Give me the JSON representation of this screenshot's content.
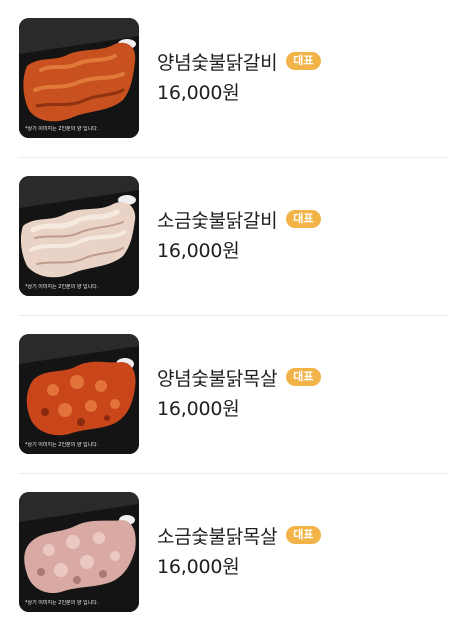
{
  "menu": {
    "items": [
      {
        "name": "양념숯불닭갈비",
        "badge": "대표",
        "price": "16,000원",
        "image_caption": "*상기 이미지는 2인분의 양 입니다.",
        "meat_color": "#c8511f",
        "meat_highlight": "#e07a3a",
        "meat_shadow": "#8e3210"
      },
      {
        "name": "소금숯불닭갈비",
        "badge": "대표",
        "price": "16,000원",
        "image_caption": "*상기 이미지는 2인분의 양 입니다.",
        "meat_color": "#e9d3c6",
        "meat_highlight": "#f6e9e0",
        "meat_shadow": "#bf9c8c"
      },
      {
        "name": "양념숯불닭목살",
        "badge": "대표",
        "price": "16,000원",
        "image_caption": "*상기 이미지는 2인분의 양 입니다.",
        "meat_color": "#c9461a",
        "meat_highlight": "#e2733a",
        "meat_shadow": "#8a2a0c"
      },
      {
        "name": "소금숯불닭목살",
        "badge": "대표",
        "price": "16,000원",
        "image_caption": "*상기 이미지는 2인분의 양 입니다.",
        "meat_color": "#d9aaa4",
        "meat_highlight": "#ecc8c2",
        "meat_shadow": "#a97a73"
      }
    ]
  },
  "colors": {
    "badge_background": "#f2b349",
    "text": "#1f1f1f",
    "divider": "#ececec",
    "tray": "#141414"
  }
}
